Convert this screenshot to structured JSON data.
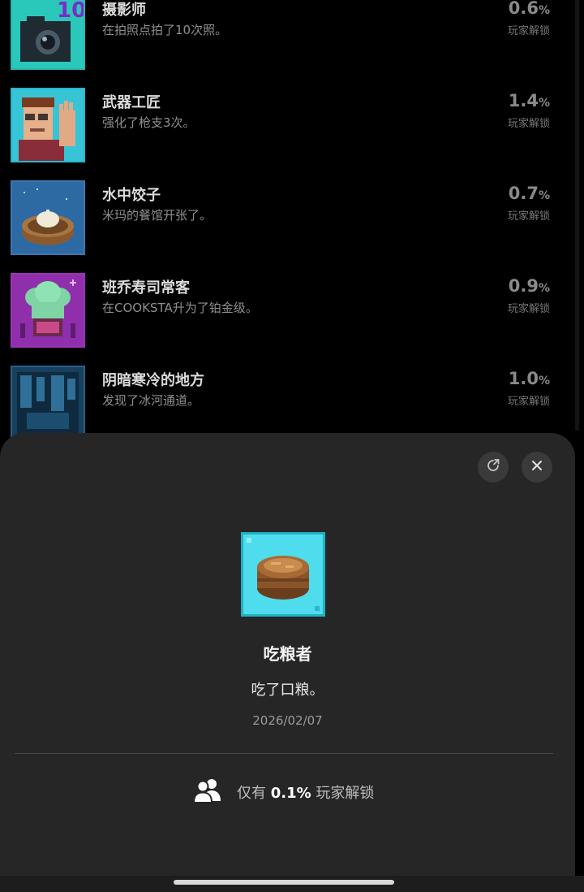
{
  "achievements": [
    {
      "title": "摄影师",
      "description": "在拍照点拍了10次照。",
      "percent": "0.6",
      "percent_unit": "%",
      "unlock_label": "玩家解锁",
      "icon": "camera-icon",
      "frame_color": "#26b9b1"
    },
    {
      "title": "武器工匠",
      "description": "强化了枪支3次。",
      "percent": "1.4",
      "percent_unit": "%",
      "unlock_label": "玩家解锁",
      "icon": "waving-man-icon",
      "frame_color": "#27b6cc"
    },
    {
      "title": "水中饺子",
      "description": "米玛的餐馆开张了。",
      "percent": "0.7",
      "percent_unit": "%",
      "unlock_label": "玩家解锁",
      "icon": "dumpling-steamer-icon",
      "frame_color": "#3a77b0"
    },
    {
      "title": "班乔寿司常客",
      "description": "在COOKSTA升为了铂金级。",
      "percent": "0.9",
      "percent_unit": "%",
      "unlock_label": "玩家解锁",
      "icon": "chef-hat-icon",
      "frame_color": "#9a32b6"
    },
    {
      "title": "阴暗寒冷的地方",
      "description": "发现了冰河通道。",
      "percent": "1.0",
      "percent_unit": "%",
      "unlock_label": "玩家解锁",
      "icon": "ice-cave-icon",
      "frame_color": "#2a5f86"
    }
  ],
  "detail": {
    "share_icon": "share-icon",
    "close_icon": "close-icon",
    "badge_icon": "rice-bowl-icon",
    "name": "吃粮者",
    "description": "吃了口粮。",
    "date": "2026/02/07",
    "rarity_icon": "people-icon",
    "rarity_prefix": "仅有 ",
    "rarity_value": "0.1%",
    "rarity_suffix": " 玩家解锁"
  }
}
